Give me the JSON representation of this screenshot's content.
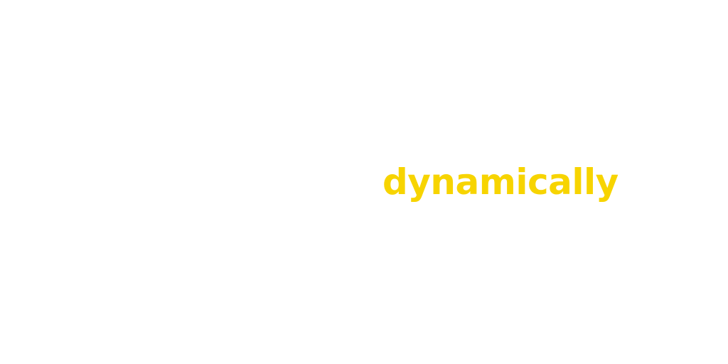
{
  "text": {
    "word": "dynamically"
  },
  "colors": {
    "background": "#ffffff",
    "word": "#f7d400"
  }
}
